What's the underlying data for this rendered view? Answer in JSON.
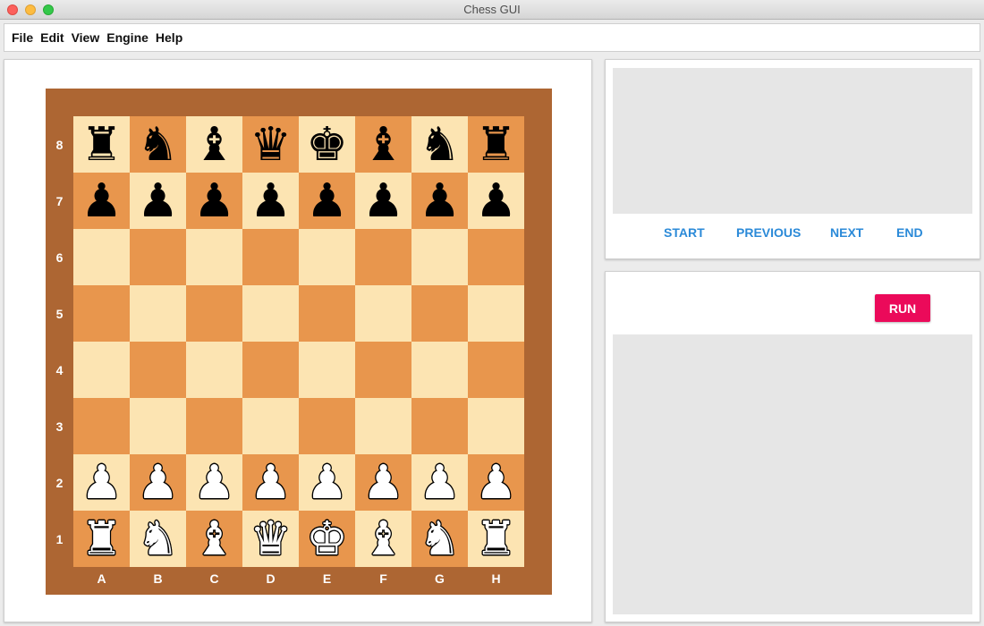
{
  "window": {
    "title": "Chess GUI"
  },
  "menu": {
    "items": [
      "File",
      "Edit",
      "View",
      "Engine",
      "Help"
    ]
  },
  "board": {
    "ranks": [
      "8",
      "7",
      "6",
      "5",
      "4",
      "3",
      "2",
      "1"
    ],
    "files": [
      "A",
      "B",
      "C",
      "D",
      "E",
      "F",
      "G",
      "H"
    ],
    "position": [
      [
        "bR",
        "bN",
        "bB",
        "bQ",
        "bK",
        "bB",
        "bN",
        "bR"
      ],
      [
        "bP",
        "bP",
        "bP",
        "bP",
        "bP",
        "bP",
        "bP",
        "bP"
      ],
      [
        "",
        "",
        "",
        "",
        "",
        "",
        "",
        ""
      ],
      [
        "",
        "",
        "",
        "",
        "",
        "",
        "",
        ""
      ],
      [
        "",
        "",
        "",
        "",
        "",
        "",
        "",
        ""
      ],
      [
        "",
        "",
        "",
        "",
        "",
        "",
        "",
        ""
      ],
      [
        "wP",
        "wP",
        "wP",
        "wP",
        "wP",
        "wP",
        "wP",
        "wP"
      ],
      [
        "wR",
        "wN",
        "wB",
        "wQ",
        "wK",
        "wB",
        "wN",
        "wR"
      ]
    ],
    "colors": {
      "frame": "#ad6633",
      "light": "#fce4b2",
      "dark": "#e8964d",
      "labels": "#ffffff"
    }
  },
  "navigation": {
    "start": "START",
    "previous": "PREVIOUS",
    "next": "NEXT",
    "end": "END",
    "color": "#2b8ad8"
  },
  "engine": {
    "run_label": "RUN",
    "run_color": "#eb0a5a"
  }
}
